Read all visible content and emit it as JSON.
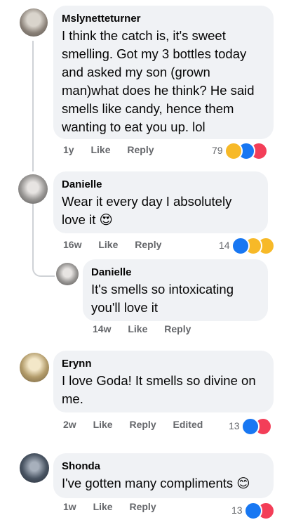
{
  "comments": [
    {
      "author": "Mslynetteturner",
      "lines": [
        "I think the catch is, it's sweet",
        "smelling. Got my 3 bottles today",
        "and asked my son (grown",
        "man)what does he think? He said",
        "smells like candy, hence them",
        "wanting to eat you up. lol"
      ],
      "time": "1y",
      "like": "Like",
      "reply": "Reply",
      "reaction_count": "79",
      "reactions": [
        "haha",
        "like",
        "love"
      ]
    },
    {
      "author": "Danielle",
      "lines": [
        "Wear it every day I absolutely",
        "love it 😍"
      ],
      "time": "16w",
      "like": "Like",
      "reply": "Reply",
      "reaction_count": "14",
      "reactions": [
        "like",
        "haha",
        "wow"
      ]
    },
    {
      "author": "Danielle",
      "lines": [
        "It's smells so intoxicating",
        "you'll love it"
      ],
      "time": "14w",
      "like": "Like",
      "reply": "Reply"
    },
    {
      "author": "Erynn",
      "lines": [
        "I love Goda! It smells so divine on",
        "me."
      ],
      "time": "2w",
      "like": "Like",
      "reply": "Reply",
      "edited": "Edited",
      "reaction_count": "13",
      "reactions": [
        "like",
        "love"
      ]
    },
    {
      "author": "Shonda",
      "lines": [
        "I've gotten many compliments 😊"
      ],
      "time": "1w",
      "like": "Like",
      "reply": "Reply",
      "reaction_count": "13",
      "reactions": [
        "like",
        "love"
      ]
    }
  ],
  "colors": {
    "like": "#1877f2",
    "love": "#f33e58",
    "haha": "#f7b928",
    "bubble": "#f0f2f5",
    "meta": "#65676b"
  }
}
